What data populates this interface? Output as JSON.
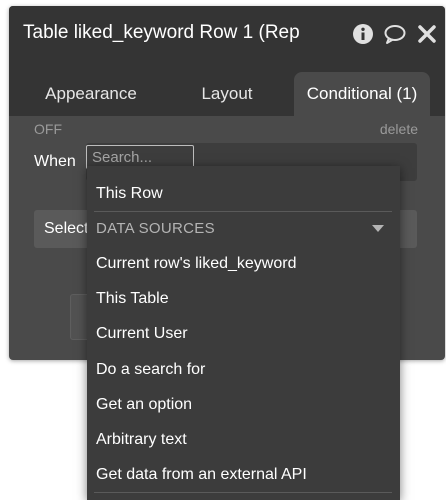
{
  "window": {
    "title": "Table liked_keyword Row 1 (Rep"
  },
  "tabs": [
    {
      "label": "Appearance"
    },
    {
      "label": "Layout"
    },
    {
      "label": "Conditional (1)"
    }
  ],
  "condition": {
    "off_label": "OFF",
    "delete_label": "delete",
    "when_label": "When",
    "search_placeholder": "Search..."
  },
  "select": {
    "label": "Select a"
  },
  "dropdown": {
    "first_item": "This Row",
    "section_header": "DATA SOURCES",
    "items": [
      "Current row's liked_keyword",
      "This Table",
      "Current User",
      "Do a search for",
      "Get an option",
      "Arbitrary text",
      "Get data from an external API"
    ]
  },
  "icons": {
    "info": "info-icon",
    "comment": "comment-icon",
    "close": "close-icon",
    "caret": "caret-down-icon"
  },
  "colors": {
    "panel": "#4a4a4a",
    "titlebar": "#343434",
    "dropdown": "#3c3c3c"
  }
}
